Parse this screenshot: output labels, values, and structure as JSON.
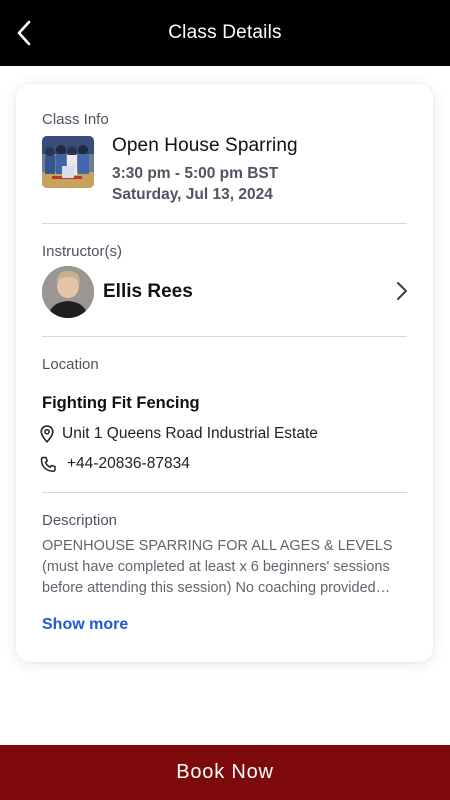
{
  "header": {
    "title": "Class Details",
    "back_icon": "chevron-left-icon"
  },
  "class_info": {
    "label": "Class Info",
    "name": "Open House Sparring",
    "time": "3:30 pm - 5:00 pm BST",
    "date": "Saturday, Jul 13, 2024"
  },
  "instructors": {
    "label": "Instructor(s)",
    "items": [
      {
        "name": "Ellis Rees"
      }
    ]
  },
  "location": {
    "label": "Location",
    "name": "Fighting Fit Fencing",
    "address": "Unit 1 Queens Road Industrial Estate",
    "phone": "+44-20836-87834"
  },
  "description": {
    "label": "Description",
    "text": "OPENHOUSE SPARRING FOR ALL AGES & LEVELS (must have completed at least x 6 beginners' sessions before attending this session) No coaching provided during this session.",
    "show_more": "Show more"
  },
  "actions": {
    "book_label": "Book Now"
  },
  "colors": {
    "header_bg": "#000000",
    "book_bg": "#7d0a0a",
    "link": "#1d5ad6"
  }
}
